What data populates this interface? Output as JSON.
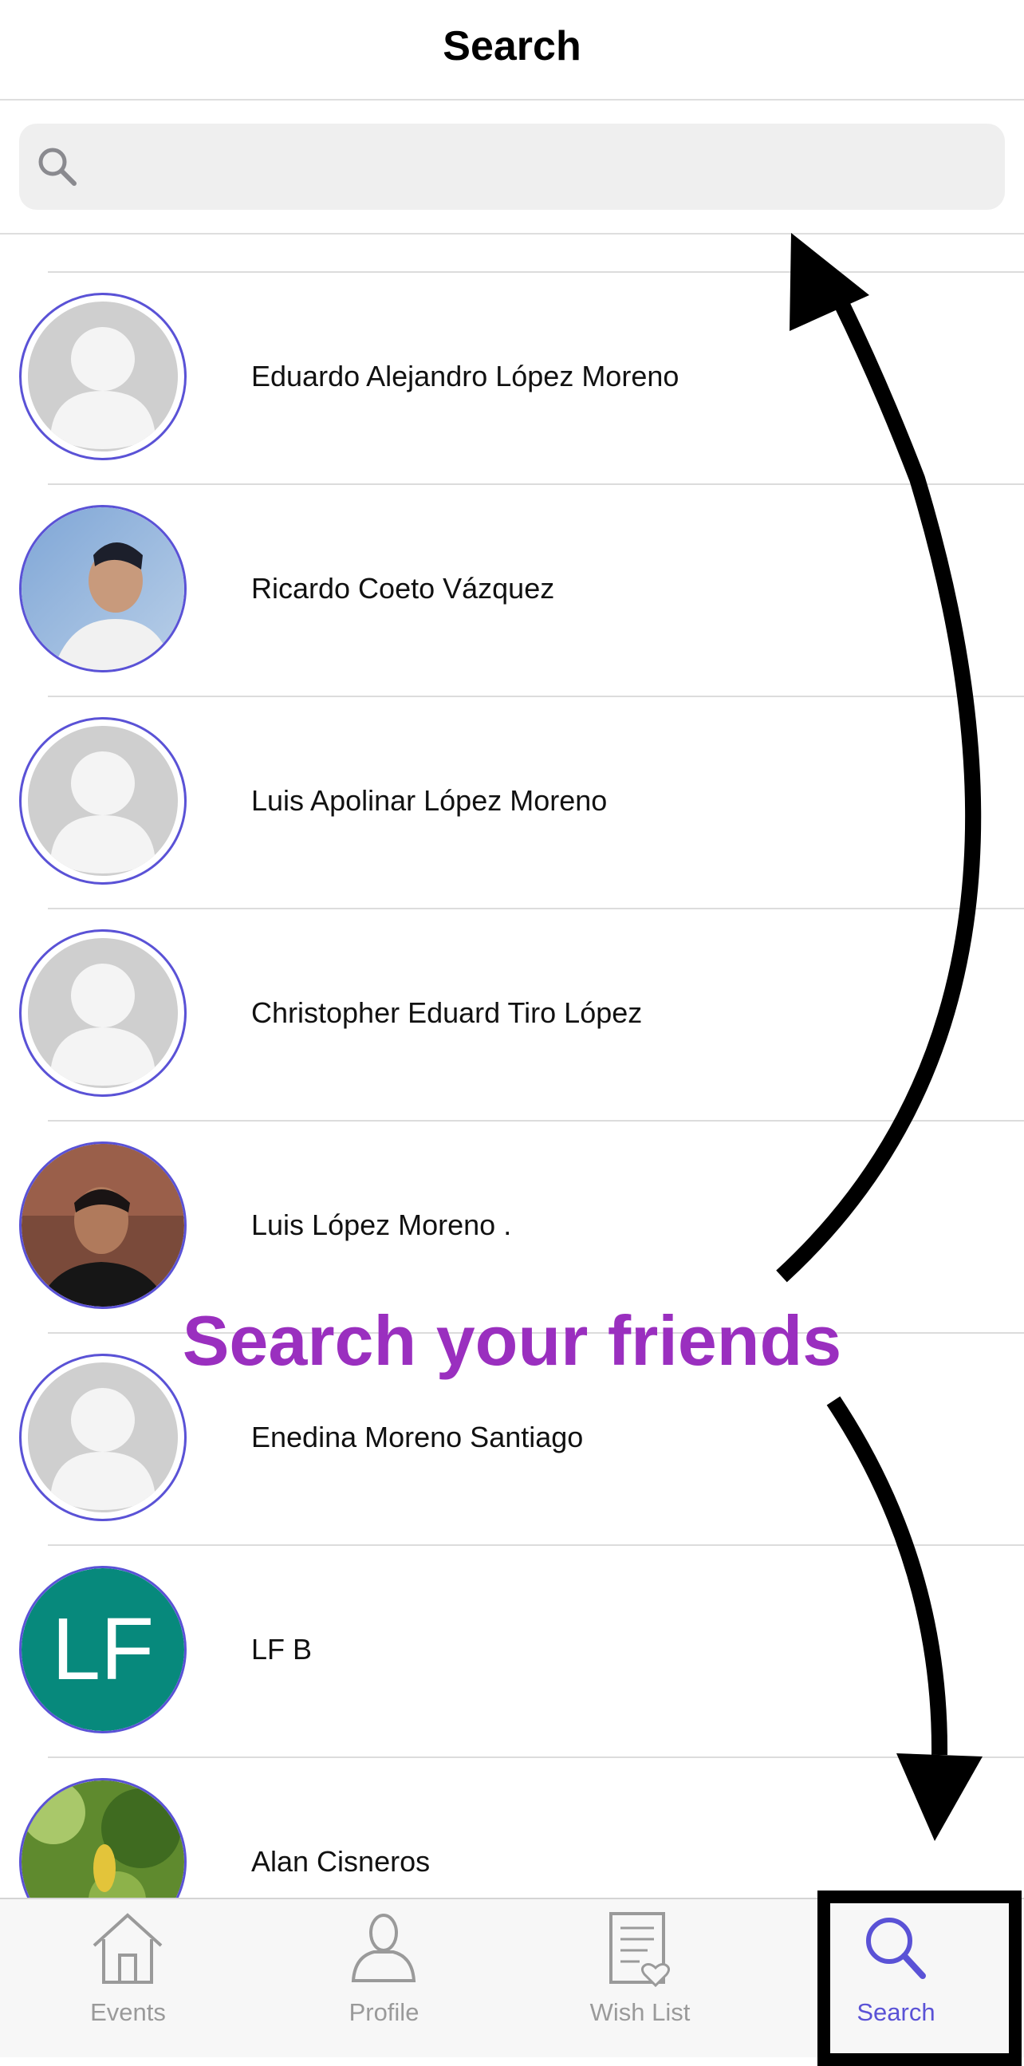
{
  "header": {
    "title": "Search"
  },
  "search": {
    "placeholder": "",
    "value": ""
  },
  "results": [
    {
      "name": "Eduardo Alejandro López Moreno",
      "avatar": "default"
    },
    {
      "name": "Ricardo Coeto Vázquez",
      "avatar": "photo"
    },
    {
      "name": "Luis Apolinar López Moreno",
      "avatar": "default"
    },
    {
      "name": "Christopher Eduard Tiro López",
      "avatar": "default"
    },
    {
      "name": "Luis López Moreno .",
      "avatar": "photo"
    },
    {
      "name": "Enedina Moreno Santiago",
      "avatar": "default"
    },
    {
      "name": "LF B",
      "avatar": "initials",
      "initials": "LF"
    },
    {
      "name": "Alan Cisneros",
      "avatar": "photo"
    }
  ],
  "tabbar": {
    "tabs": [
      {
        "label": "Events",
        "icon": "house-icon"
      },
      {
        "label": "Profile",
        "icon": "person-icon"
      },
      {
        "label": "Wish List",
        "icon": "wishlist-icon"
      },
      {
        "label": "Search",
        "icon": "search-icon",
        "active": true
      }
    ]
  },
  "annotation": {
    "text": "Search your friends"
  },
  "colors": {
    "accent": "#5a52d6",
    "callout": "#9a2fbf",
    "initials_bg": "#07897c",
    "tab_inactive": "#9a9a9a"
  }
}
